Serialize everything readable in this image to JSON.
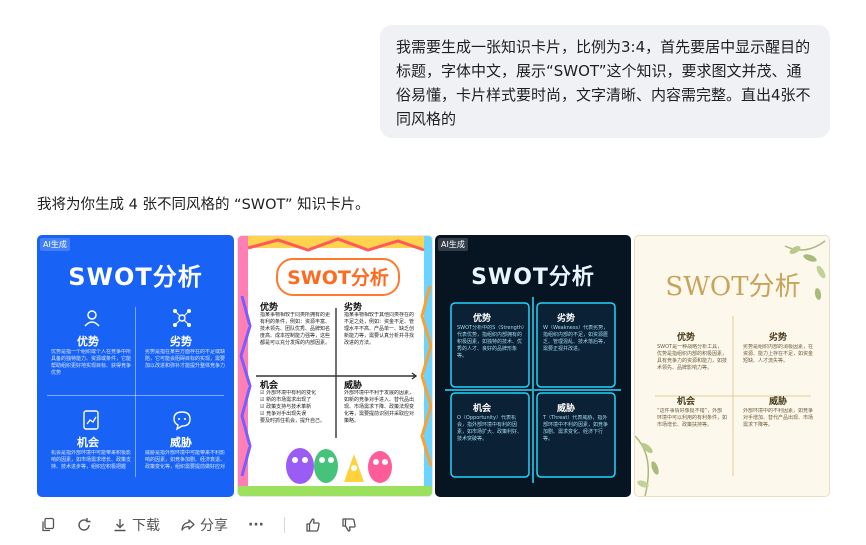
{
  "conversation": {
    "user_message": "我需要生成一张知识卡片，比例为3:4，首先要居中显示醒目的标题，字体中文，展示“SWOT”这个知识，要求图文并茂、通俗易懂，卡片样式要时尚，文字清晰、内容需完整。直出4张不同风格的",
    "assistant_reply": "我将为你生成 4 张不同风格的 “SWOT” 知识卡片。"
  },
  "cards": [
    {
      "ai_tag": "AI生成",
      "title": "SWOT分析",
      "quadrants": [
        {
          "label": "优势",
          "icon": "user-icon",
          "text": "优势是指一个组织或个人在竞争中所具备的独特能力、资源或条件，它能帮助组织更好地实现目标、获得竞争优势"
        },
        {
          "label": "劣势",
          "icon": "network-icon",
          "text": "劣势是指在某些方面存在的不足或缺陷，它可能会阻碍目标的实现，需要加以改进和弥补才能提升整体竞争力"
        },
        {
          "label": "机会",
          "icon": "report-icon",
          "text": "机会是指外部环境中可能带来积极影响的因素，如市场需求增长、政策支持、技术进步等，组织应积极把握"
        },
        {
          "label": "威胁",
          "icon": "chat-icon",
          "text": "威胁是指外部环境中可能带来不利影响的因素，如竞争加剧、经济衰退、政策变化等，组织需要提前做好应对"
        }
      ]
    },
    {
      "title": "SWOT分析",
      "quadrants": [
        {
          "label": "优势",
          "text": "指某事物相较于同类所拥有的更有利的条件，例如：资源丰富、技术领先、团队优秀、品牌知名度高、成本控制能力强等，这些都是可以充分发挥的内部因素。"
        },
        {
          "label": "劣势",
          "text": "指某事物相较于其他同类存在的不足之处，例如：资金不足、管理水平不高、产品单一、缺乏创新能力等，需要认真分析并寻找改进的方法。"
        },
        {
          "label": "机会",
          "text": "☑ 外部环境中有利的变化\n☑ 新的市场需求出现了\n☑ 政策支持与技术革新\n☑ 竞争对手出现失误\n要及时抓住机会，提升自己。"
        },
        {
          "label": "威胁",
          "text": "外部环境中不利于发展的因素，如新的竞争对手进入、替代品出现、市场需求下降、政策法规变化等，需要提前识别并采取应对策略。"
        }
      ]
    },
    {
      "ai_tag": "AI生成",
      "title": "SWOT分析",
      "quadrants": [
        {
          "label": "优势",
          "text": "SWOT分析中的S（Strength）代表优势，指组织内部拥有的积极因素，如独特的技术、优秀的人才、良好的品牌形象等。"
        },
        {
          "label": "劣势",
          "text": "W（Weakness）代表劣势，指组织内部的不足，如资源匮乏、管理混乱、技术落后等，需要正视并改进。"
        },
        {
          "label": "机会",
          "text": "O（Opportunity）代表机会，指外部环境中有利的因素，如市场扩大、政策利好、技术突破等。"
        },
        {
          "label": "威胁",
          "text": "T（Threat）代表威胁，指外部环境中不利的因素，如竞争加剧、需求变化、经济下行等。"
        }
      ]
    },
    {
      "title": "SWOT分析",
      "quadrants": [
        {
          "label": "优势",
          "text": "SWOT是一种战略分析工具，优势是指组织内部的积极因素，具有竞争力的资源和能力，如技术领先、品牌影响力等。"
        },
        {
          "label": "劣势",
          "text": "劣势是组织内部的消极因素，在资源、能力上存在不足，如资金短缺、人才流失等。"
        },
        {
          "label": "机会",
          "text": "“这件事情好像挺不错”，外部环境中可以利用的有利条件，如市场增长、政策扶持等。"
        },
        {
          "label": "威胁",
          "text": "外部环境中的不利因素，如竞争对手增加、替代产品出现、市场需求下降等。"
        }
      ]
    }
  ],
  "toolbar": {
    "copy_icon": "copy-icon",
    "regenerate_icon": "refresh-icon",
    "download_label": "下载",
    "share_label": "分享",
    "more_label": "···",
    "like_icon": "thumbs-up-icon",
    "dislike_icon": "thumbs-down-icon"
  },
  "colors": {
    "card1_bg": "#1863f5",
    "card3_bg": "#071422",
    "card3_neon": "#21d4fd",
    "card4_bg": "#fdf8ec",
    "card4_gold": "#c8a35a",
    "bubble_bg": "#eff1f5"
  }
}
